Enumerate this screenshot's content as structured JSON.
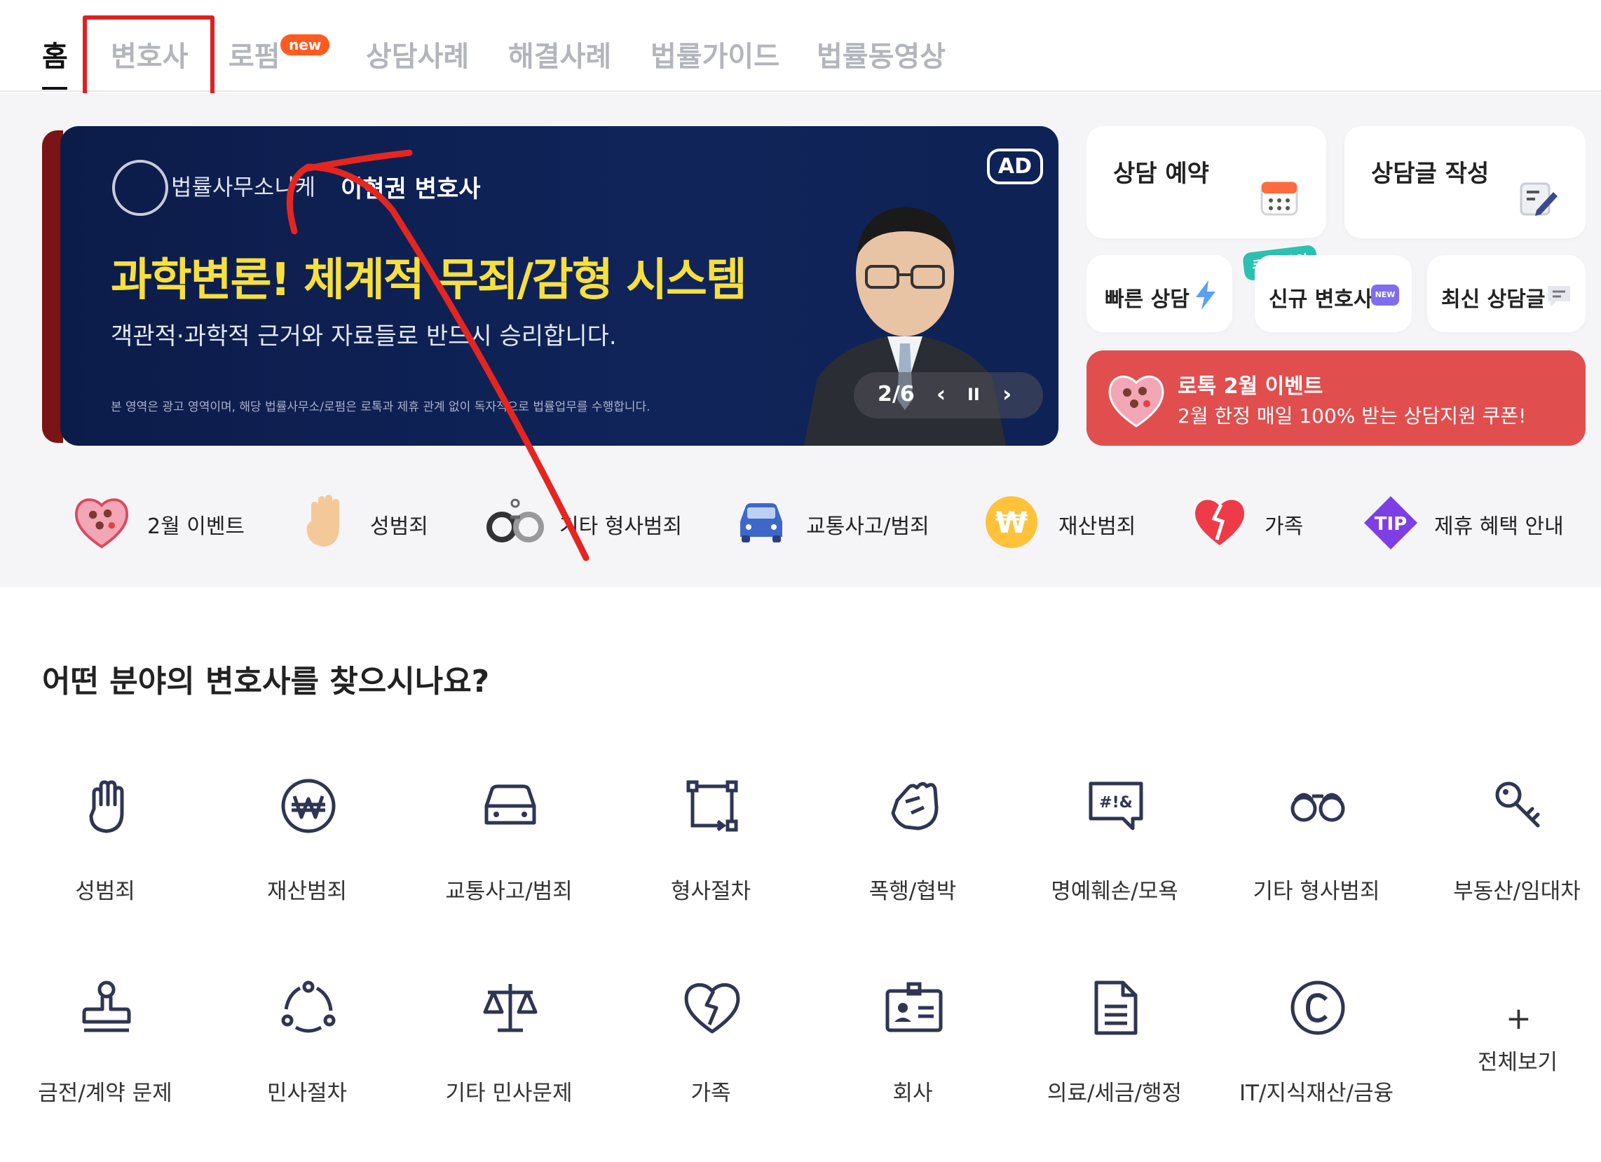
{
  "tabs": [
    {
      "label": "홈"
    },
    {
      "label": "변호사"
    },
    {
      "label": "로펌",
      "badge": "new"
    },
    {
      "label": "상담사례"
    },
    {
      "label": "해결사례"
    },
    {
      "label": "법률가이드"
    },
    {
      "label": "법률동영상"
    }
  ],
  "banner": {
    "logo_text": "법률사무소니케",
    "lawyer": "이현권 변호사",
    "ad": "AD",
    "headline": "과학변론! 체계적 무죄/감형 시스템",
    "sub": "객관적·과학적 근거와 자료들로 반드시 승리합니다.",
    "fine_print": "본 영역은 광고 영역이며, 해당 법률사무소/로펌은 로톡과 제휴 관계 없이 독자적으로 법률업무를 수행합니다.",
    "pager": "2/6",
    "prev": "‹",
    "pause": "II",
    "next": "›"
  },
  "quick": {
    "booking": "상담 예약",
    "write": "상담글 작성",
    "fast": "빠른 상담",
    "new_lawyer": "신규 변호사",
    "new_icon": "NEW",
    "coupon": "쿠폰지원",
    "latest": "최신 상담글"
  },
  "event": {
    "title": "로톡 2월 이벤트",
    "sub": "2월 한정 매일 100% 받는 상담지원 쿠폰!"
  },
  "categories": [
    {
      "label": "2월 이벤트",
      "icon": "heart-box-icon"
    },
    {
      "label": "성범죄",
      "icon": "hand-icon"
    },
    {
      "label": "기타 형사범죄",
      "icon": "handcuffs-icon"
    },
    {
      "label": "교통사고/범죄",
      "icon": "car-icon"
    },
    {
      "label": "재산범죄",
      "icon": "won-coin-icon"
    },
    {
      "label": "가족",
      "icon": "broken-heart-icon"
    },
    {
      "label": "제휴 혜택 안내",
      "icon": "tip-icon",
      "tip": "TIP"
    }
  ],
  "section_title": "어떤 분야의 변호사를 찾으시나요?",
  "fields_row1": [
    {
      "label": "성범죄",
      "icon": "hand-icon"
    },
    {
      "label": "재산범죄",
      "icon": "won-icon"
    },
    {
      "label": "교통사고/범죄",
      "icon": "car-icon"
    },
    {
      "label": "형사절차",
      "icon": "process-icon"
    },
    {
      "label": "폭행/협박",
      "icon": "fist-icon"
    },
    {
      "label": "명예훼손/모욕",
      "icon": "speech-swear-icon",
      "glyph": "#!&"
    },
    {
      "label": "기타 형사범죄",
      "icon": "handcuffs-icon"
    },
    {
      "label": "부동산/임대차",
      "icon": "key-icon"
    }
  ],
  "fields_row2": [
    {
      "label": "금전/계약 문제",
      "icon": "stamp-icon"
    },
    {
      "label": "민사절차",
      "icon": "cycle-icon"
    },
    {
      "label": "기타 민사문제",
      "icon": "scales-icon"
    },
    {
      "label": "가족",
      "icon": "broken-heart-icon"
    },
    {
      "label": "회사",
      "icon": "id-card-icon"
    },
    {
      "label": "의료/세금/행정",
      "icon": "document-icon"
    },
    {
      "label": "IT/지식재산/금융",
      "icon": "copyright-icon"
    }
  ],
  "more": {
    "plus": "+",
    "label": "전체보기"
  },
  "colors": {
    "accent_red": "#e04e4e",
    "navy": "#10245a",
    "headline_yellow": "#f7e03c",
    "badge_orange": "#ff5a1f",
    "teal": "#2bc0b0",
    "icon_navy": "#2f3553"
  }
}
